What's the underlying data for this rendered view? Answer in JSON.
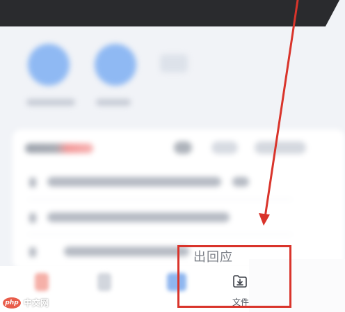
{
  "overlay_label": "出回应",
  "bottom_nav": {
    "file_label": "文件",
    "file_icon": "folder-download-icon"
  },
  "watermark": {
    "badge": "php",
    "text": "中文网"
  },
  "colors": {
    "annotation_red": "#d9342b",
    "dark_header": "#2a2b2e",
    "accent_blue": "#8fb9f3",
    "label_gray": "#7d8189"
  }
}
